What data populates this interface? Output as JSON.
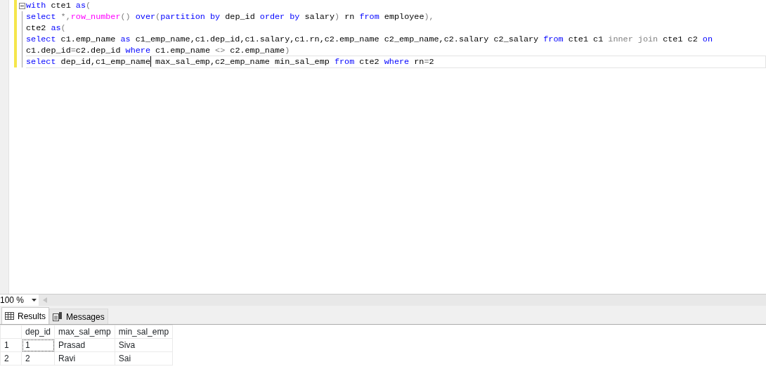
{
  "editor": {
    "lines": [
      {
        "collapsible": true,
        "current": false,
        "tokens": [
          {
            "kind": "keyword",
            "text": "with"
          },
          {
            "kind": "plain",
            "text": " cte1 "
          },
          {
            "kind": "keyword",
            "text": "as"
          },
          {
            "kind": "operator",
            "text": "("
          }
        ]
      },
      {
        "collapsible": false,
        "current": false,
        "tokens": [
          {
            "kind": "keyword",
            "text": "select"
          },
          {
            "kind": "operator",
            "text": " *,"
          },
          {
            "kind": "function",
            "text": "row_number"
          },
          {
            "kind": "operator",
            "text": "() "
          },
          {
            "kind": "keyword",
            "text": "over"
          },
          {
            "kind": "operator",
            "text": "("
          },
          {
            "kind": "keyword",
            "text": "partition by"
          },
          {
            "kind": "plain",
            "text": " dep_id "
          },
          {
            "kind": "keyword",
            "text": "order by"
          },
          {
            "kind": "plain",
            "text": " salary"
          },
          {
            "kind": "operator",
            "text": ")"
          },
          {
            "kind": "plain",
            "text": " rn "
          },
          {
            "kind": "keyword",
            "text": "from"
          },
          {
            "kind": "plain",
            "text": " employee"
          },
          {
            "kind": "operator",
            "text": "),"
          }
        ]
      },
      {
        "collapsible": false,
        "current": false,
        "tokens": [
          {
            "kind": "plain",
            "text": "cte2 "
          },
          {
            "kind": "keyword",
            "text": "as"
          },
          {
            "kind": "operator",
            "text": "("
          }
        ]
      },
      {
        "collapsible": false,
        "current": false,
        "tokens": [
          {
            "kind": "keyword",
            "text": "select"
          },
          {
            "kind": "plain",
            "text": " c1.emp_name "
          },
          {
            "kind": "keyword",
            "text": "as"
          },
          {
            "kind": "plain",
            "text": " c1_emp_name,c1.dep_id,c1.salary,c1.rn,c2.emp_name c2_emp_name,c2.salary c2_salary "
          },
          {
            "kind": "keyword",
            "text": "from"
          },
          {
            "kind": "plain",
            "text": " cte1 c1 "
          },
          {
            "kind": "operator",
            "text": "inner join"
          },
          {
            "kind": "plain",
            "text": " cte1 c2 "
          },
          {
            "kind": "keyword",
            "text": "on"
          }
        ]
      },
      {
        "collapsible": false,
        "current": false,
        "tokens": [
          {
            "kind": "plain",
            "text": "c1.dep_id"
          },
          {
            "kind": "operator",
            "text": "="
          },
          {
            "kind": "plain",
            "text": "c2.dep_id "
          },
          {
            "kind": "keyword",
            "text": "where"
          },
          {
            "kind": "plain",
            "text": " c1.emp_name "
          },
          {
            "kind": "operator",
            "text": "<>"
          },
          {
            "kind": "plain",
            "text": " c2.emp_name"
          },
          {
            "kind": "operator",
            "text": ")"
          }
        ]
      },
      {
        "collapsible": false,
        "current": true,
        "tokens": [
          {
            "kind": "keyword",
            "text": "select"
          },
          {
            "kind": "plain",
            "text": " dep_id,c1_emp_name"
          },
          {
            "kind": "cursor"
          },
          {
            "kind": "plain",
            "text": " max_sal_emp,c2_emp_name min_sal_emp "
          },
          {
            "kind": "keyword",
            "text": "from"
          },
          {
            "kind": "plain",
            "text": " cte2 "
          },
          {
            "kind": "keyword",
            "text": "where"
          },
          {
            "kind": "plain",
            "text": " rn"
          },
          {
            "kind": "operator",
            "text": "="
          },
          {
            "kind": "plain",
            "text": "2"
          }
        ]
      }
    ]
  },
  "zoom": {
    "value": "100 %"
  },
  "tabs": [
    {
      "label": "Results",
      "kind": "grid",
      "selected": true
    },
    {
      "label": "Messages",
      "kind": "messages",
      "selected": false
    }
  ],
  "results": {
    "columns": [
      "dep_id",
      "max_sal_emp",
      "min_sal_emp"
    ],
    "rows": [
      {
        "number": "1",
        "cells": [
          {
            "text": "1",
            "focused": true
          },
          {
            "text": "Prasad",
            "focused": false
          },
          {
            "text": "Siva",
            "focused": false
          }
        ]
      },
      {
        "number": "2",
        "cells": [
          {
            "text": "2",
            "focused": false
          },
          {
            "text": "Ravi",
            "focused": false
          },
          {
            "text": "Sai",
            "focused": false
          }
        ]
      }
    ]
  }
}
